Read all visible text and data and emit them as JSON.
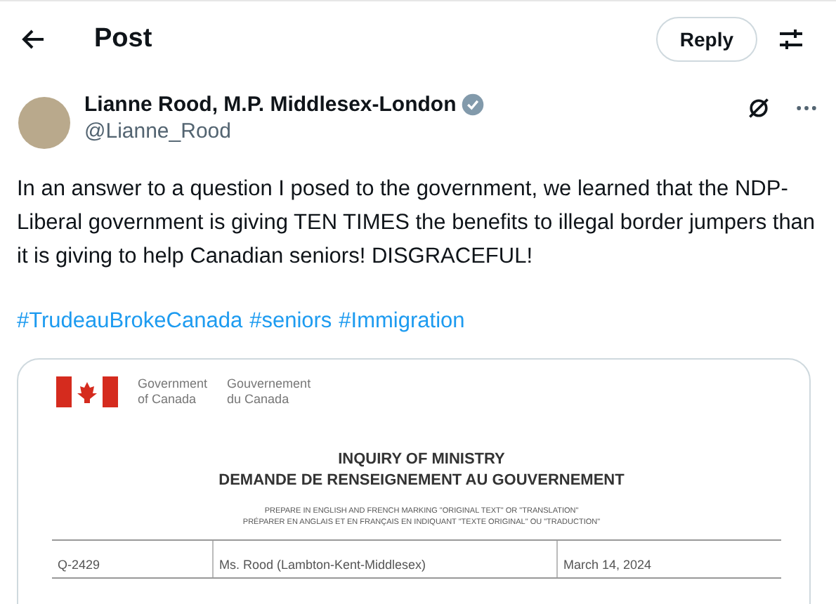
{
  "header": {
    "title": "Post",
    "reply_button": "Reply"
  },
  "author": {
    "name": "Lianne Rood, M.P. Middlesex-London",
    "verified": true,
    "handle": "@Lianne_Rood"
  },
  "post": {
    "text": "In an answer to a question I posed to the government, we learned that the NDP-Liberal government is giving TEN TIMES the benefits to illegal border jumpers than it is giving to help Canadian seniors! DISGRACEFUL!",
    "hashtags": [
      "#TrudeauBrokeCanada",
      "#seniors",
      "#Immigration"
    ]
  },
  "document": {
    "gov_en": [
      "Government",
      "of Canada"
    ],
    "gov_fr": [
      "Gouvernement",
      "du Canada"
    ],
    "title": "INQUIRY OF MINISTRY",
    "subtitle": "DEMANDE DE RENSEIGNEMENT AU GOUVERNEMENT",
    "instructions": [
      "PREPARE IN ENGLISH AND FRENCH MARKING \"ORIGINAL TEXT\" OR \"TRANSLATION\"",
      "PRÉPARER EN ANGLAIS ET EN FRANÇAIS EN INDIQUANT \"TEXTE ORIGINAL\" OU \"TRADUCTION\""
    ],
    "table_row": [
      "Q-2429",
      "Ms. Rood (Lambton-Kent-Middlesex)",
      "March 14, 2024"
    ]
  }
}
